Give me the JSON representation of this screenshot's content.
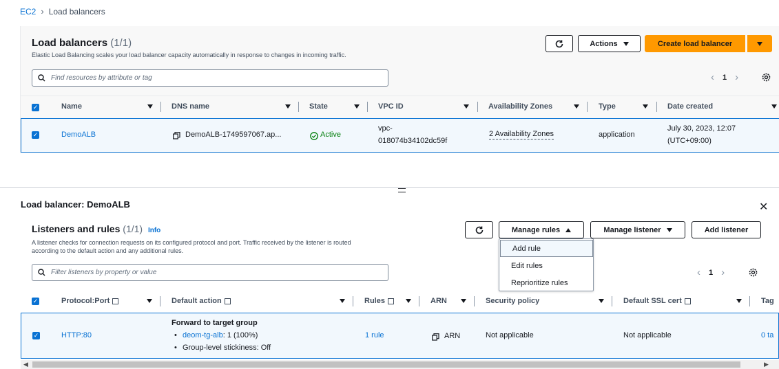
{
  "breadcrumb": {
    "root": "EC2",
    "current": "Load balancers"
  },
  "lb_panel": {
    "title": "Load balancers",
    "count": "(1/1)",
    "description": "Elastic Load Balancing scales your load balancer capacity automatically in response to changes in incoming traffic.",
    "actions_label": "Actions",
    "create_label": "Create load balancer",
    "search_placeholder": "Find resources by attribute or tag",
    "page": "1",
    "columns": [
      "Name",
      "DNS name",
      "State",
      "VPC ID",
      "Availability Zones",
      "Type",
      "Date created"
    ],
    "row": {
      "name": "DemoALB",
      "dns": "DemoALB-1749597067.ap...",
      "state": "Active",
      "vpc_line1": "vpc-",
      "vpc_line2": "018074b34102dc59f",
      "azs": "2 Availability Zones",
      "type": "application",
      "date_line1": "July 30, 2023, 12:07",
      "date_line2": "(UTC+09:00)"
    }
  },
  "detail": {
    "title": "Load balancer: DemoALB"
  },
  "listeners": {
    "title": "Listeners and rules",
    "count": "(1/1)",
    "info": "Info",
    "description_line1": "A listener checks for connection requests on its configured protocol and port. Traffic received by the listener is routed",
    "description_line2": "according to the default action and any additional rules.",
    "manage_rules_label": "Manage rules",
    "manage_listener_label": "Manage listener",
    "add_listener_label": "Add listener",
    "search_placeholder": "Filter listeners by property or value",
    "page": "1",
    "columns": [
      "Protocol:Port",
      "Default action",
      "Rules",
      "ARN",
      "Security policy",
      "Default SSL cert",
      "Tag"
    ],
    "row": {
      "protocol": "HTTP:80",
      "action_title": "Forward to target group",
      "tg_name": "deom-tg-alb",
      "tg_weight": ": 1 (100%)",
      "stickiness": "Group-level stickiness: Off",
      "rules": "1 rule",
      "arn": "ARN",
      "security_policy": "Not applicable",
      "ssl_cert": "Not applicable",
      "tags": "0 ta"
    },
    "dropdown": [
      "Add rule",
      "Edit rules",
      "Reprioritize rules"
    ]
  },
  "colors": {
    "accent": "#0972d3",
    "primary_button": "#ff9900",
    "success": "#037f0c"
  }
}
